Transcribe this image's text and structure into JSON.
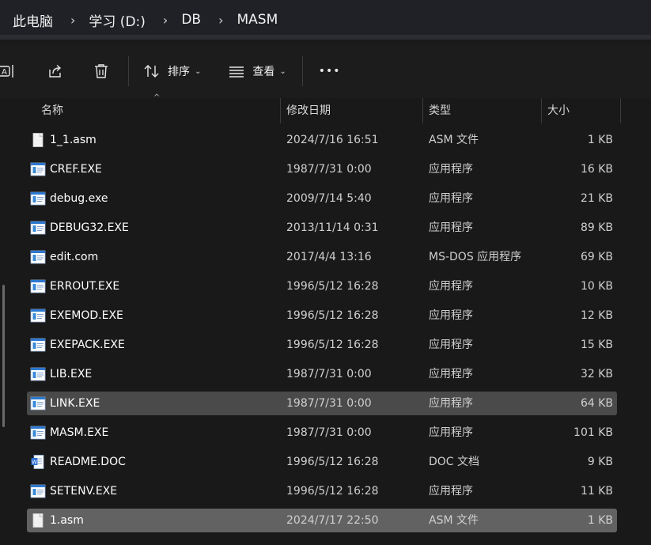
{
  "breadcrumb": [
    "此电脑",
    "学习 (D:)",
    "DB",
    "MASM"
  ],
  "toolbar": {
    "sort_label": "排序",
    "view_label": "查看",
    "more_label": "•••"
  },
  "columns": {
    "name": "名称",
    "date": "修改日期",
    "type": "类型",
    "size": "大小"
  },
  "files": [
    {
      "name": "1_1.asm",
      "date": "2024/7/16 16:51",
      "type": "ASM 文件",
      "size": "1 KB",
      "icon": "file"
    },
    {
      "name": "CREF.EXE",
      "date": "1987/7/31 0:00",
      "type": "应用程序",
      "size": "16 KB",
      "icon": "exe"
    },
    {
      "name": "debug.exe",
      "date": "2009/7/14 5:40",
      "type": "应用程序",
      "size": "21 KB",
      "icon": "exe"
    },
    {
      "name": "DEBUG32.EXE",
      "date": "2013/11/14 0:31",
      "type": "应用程序",
      "size": "89 KB",
      "icon": "exe"
    },
    {
      "name": "edit.com",
      "date": "2017/4/4 13:16",
      "type": "MS-DOS 应用程序",
      "size": "69 KB",
      "icon": "exe"
    },
    {
      "name": "ERROUT.EXE",
      "date": "1996/5/12 16:28",
      "type": "应用程序",
      "size": "10 KB",
      "icon": "exe"
    },
    {
      "name": "EXEMOD.EXE",
      "date": "1996/5/12 16:28",
      "type": "应用程序",
      "size": "12 KB",
      "icon": "exe"
    },
    {
      "name": "EXEPACK.EXE",
      "date": "1996/5/12 16:28",
      "type": "应用程序",
      "size": "15 KB",
      "icon": "exe"
    },
    {
      "name": "LIB.EXE",
      "date": "1987/7/31 0:00",
      "type": "应用程序",
      "size": "32 KB",
      "icon": "exe"
    },
    {
      "name": "LINK.EXE",
      "date": "1987/7/31 0:00",
      "type": "应用程序",
      "size": "64 KB",
      "icon": "exe",
      "state": "hover"
    },
    {
      "name": "MASM.EXE",
      "date": "1987/7/31 0:00",
      "type": "应用程序",
      "size": "101 KB",
      "icon": "exe"
    },
    {
      "name": "README.DOC",
      "date": "1996/5/12 16:28",
      "type": "DOC 文档",
      "size": "9 KB",
      "icon": "doc"
    },
    {
      "name": "SETENV.EXE",
      "date": "1996/5/12 16:28",
      "type": "应用程序",
      "size": "11 KB",
      "icon": "exe"
    },
    {
      "name": "1.asm",
      "date": "2024/7/17 22:50",
      "type": "ASM 文件",
      "size": "1 KB",
      "icon": "file",
      "state": "selected"
    }
  ],
  "colors": {
    "background": "#191919",
    "hover_row": "#4a4a4a",
    "selected_row": "#626262",
    "doc_blue": "#2b6fd6",
    "exe_blue": "#3a8ad8"
  }
}
